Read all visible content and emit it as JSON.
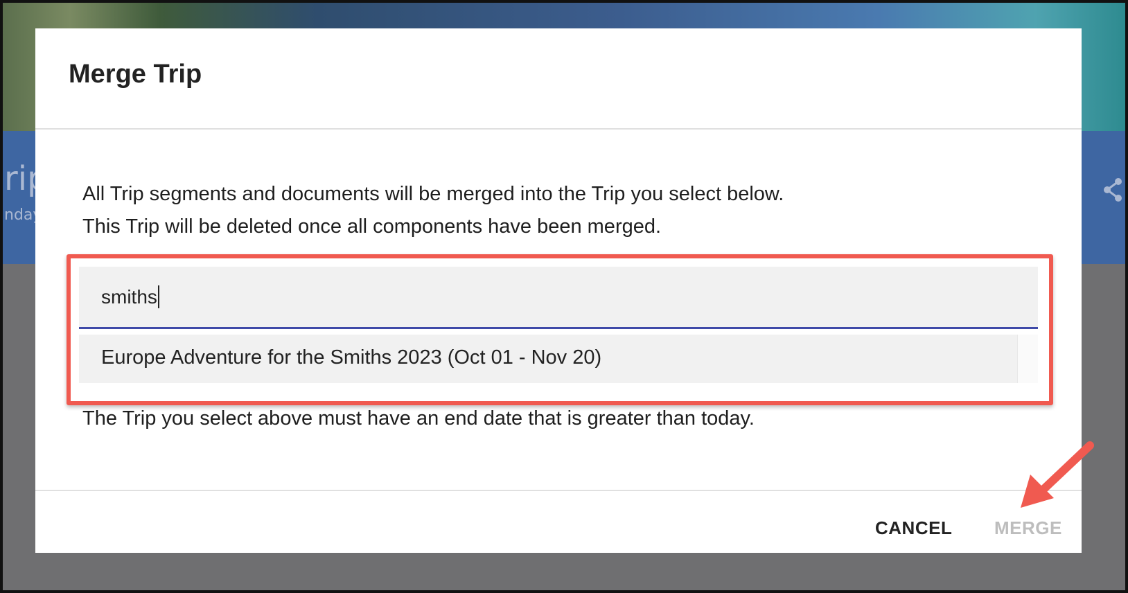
{
  "background": {
    "page_title_fragment": "rip",
    "subtitle_fragment": "nday",
    "share_icon": "share-icon"
  },
  "dialog": {
    "title": "Merge Trip",
    "description_line1": "All Trip segments and documents will be merged into the Trip you select below.",
    "description_line2": "This Trip will be deleted once all components have been merged.",
    "search": {
      "value": "smiths",
      "underline_color": "#3f4aa8"
    },
    "results": [
      {
        "label": "Europe Adventure for the Smiths 2023 (Oct 01 - Nov 20)"
      }
    ],
    "note": "The Trip you select above must have an end date that is greater than today.",
    "actions": {
      "cancel_label": "CANCEL",
      "merge_label": "MERGE"
    }
  },
  "annotation": {
    "highlight_color": "#f05a50",
    "arrow_icon": "arrow-icon"
  }
}
